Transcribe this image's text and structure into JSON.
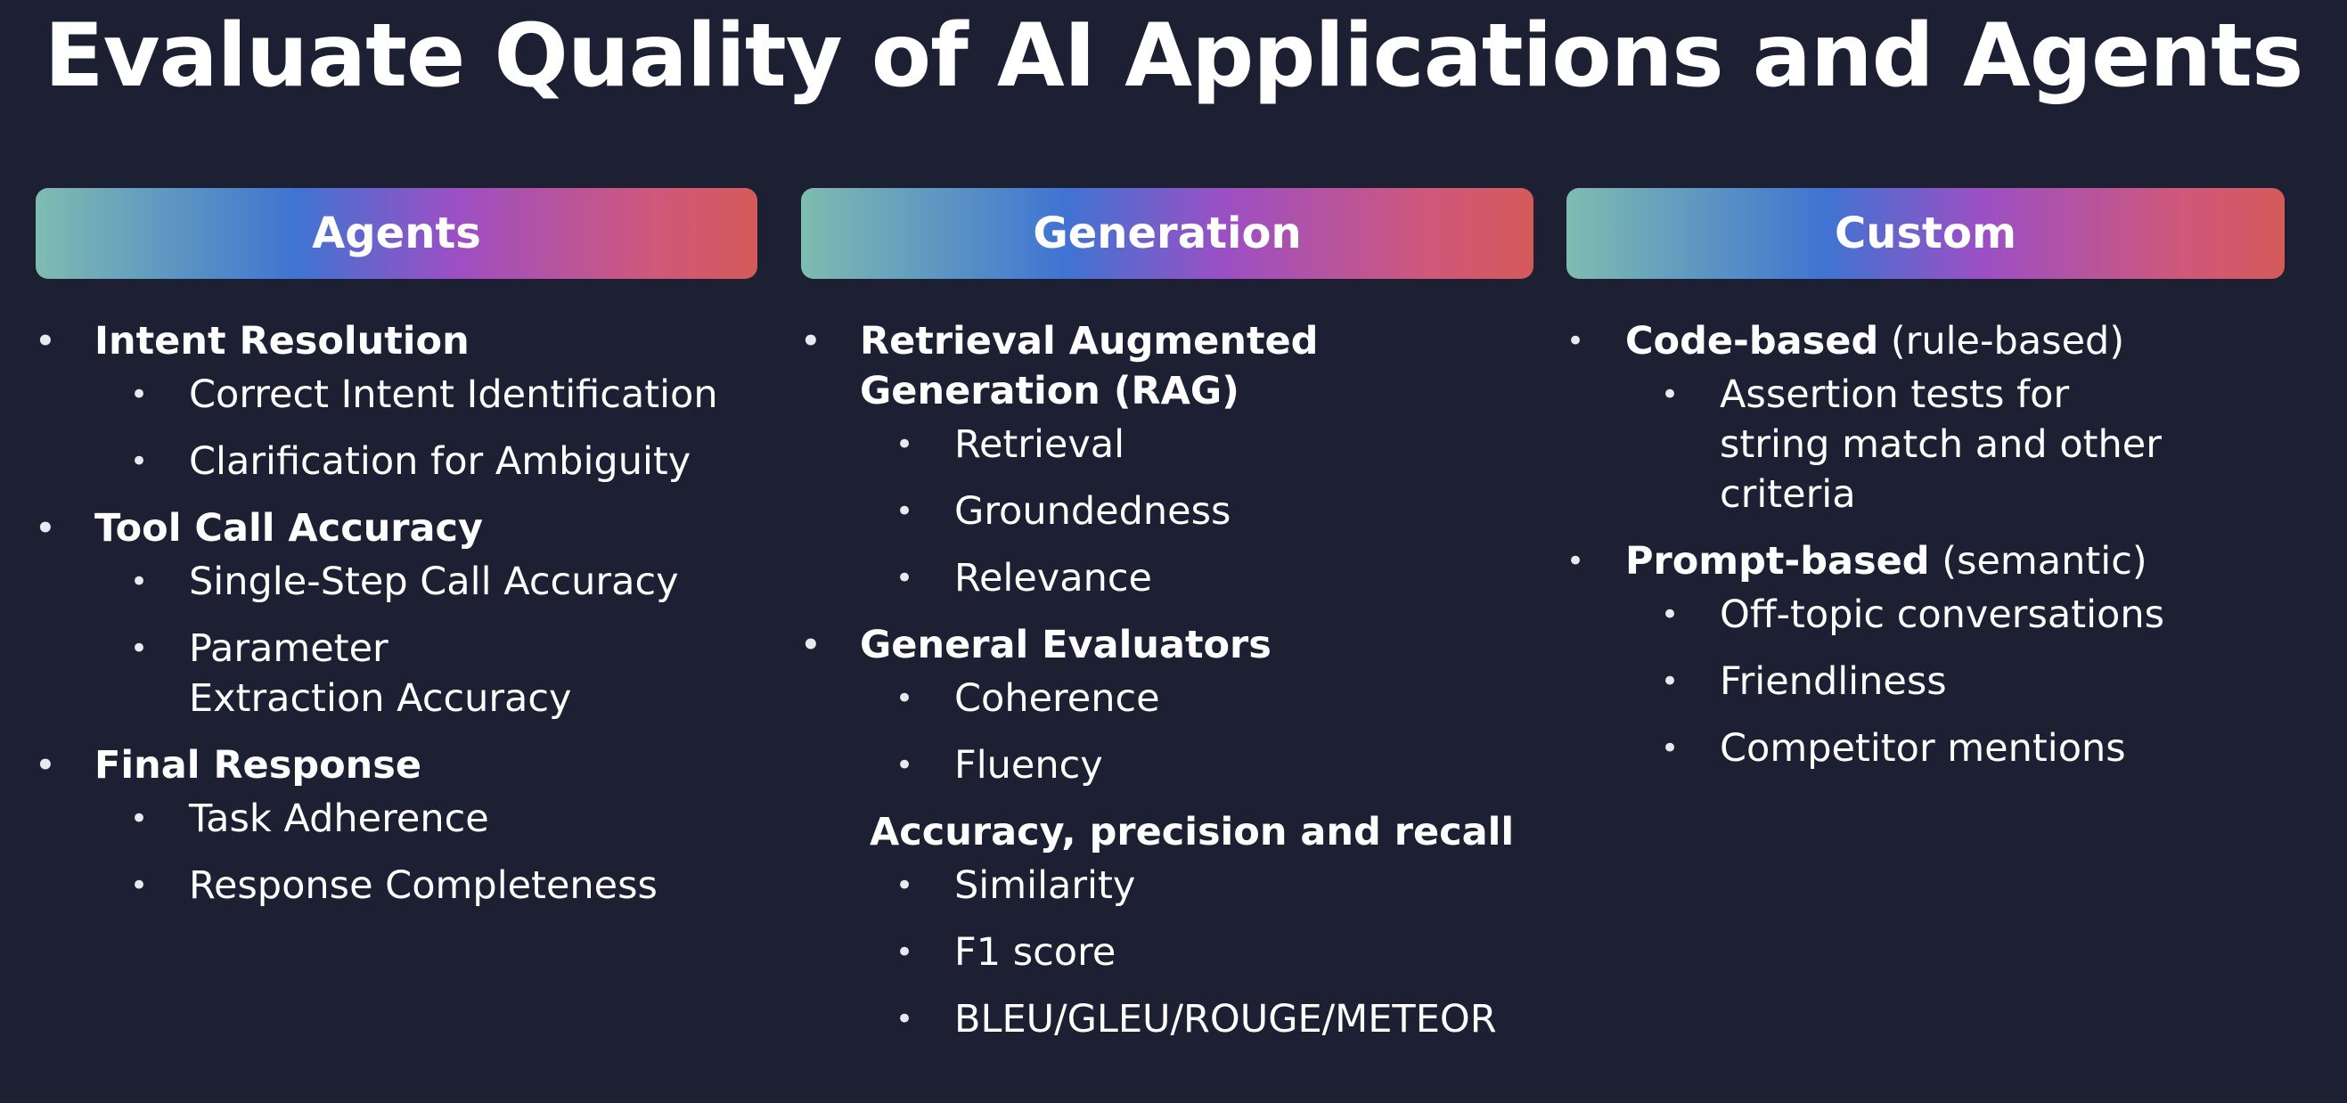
{
  "title": "Evaluate Quality of AI Applications and Agents",
  "columns": [
    {
      "header": "Agents",
      "items": [
        {
          "label": "Intent Resolution",
          "subs": [
            "Correct Intent Identification",
            "Clarification for Ambiguity"
          ]
        },
        {
          "label": "Tool Call Accuracy",
          "subs": [
            "Single-Step Call Accuracy",
            "Parameter Extraction Accuracy"
          ]
        },
        {
          "label": "Final Response",
          "subs": [
            "Task Adherence",
            "Response Completeness"
          ]
        }
      ]
    },
    {
      "header": "Generation",
      "items": [
        {
          "label": "Retrieval Augmented Generation (RAG)",
          "subs": [
            "Retrieval",
            "Groundedness",
            "Relevance"
          ]
        },
        {
          "label": "General Evaluators",
          "subs": [
            "Coherence",
            "Fluency"
          ]
        },
        {
          "label": "Accuracy, precision and recall",
          "subs": [
            "Similarity",
            "F1 score",
            "BLEU/GLEU/ROUGE/METEOR"
          ]
        }
      ]
    },
    {
      "header": "Custom",
      "items": [
        {
          "label": "Code-based",
          "note": " (rule-based)",
          "subs": [
            "Assertion tests for string match and other criteria"
          ]
        },
        {
          "label": "Prompt-based",
          "note": " (semantic)",
          "subs": [
            "Off-topic conversations",
            "Friendliness",
            "Competitor mentions"
          ]
        }
      ]
    }
  ]
}
